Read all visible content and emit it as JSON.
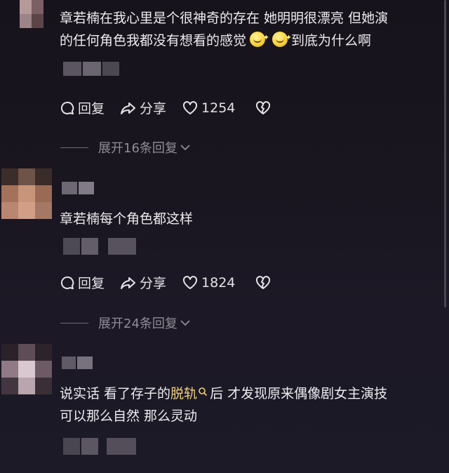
{
  "comments": [
    {
      "text_a": "章若楠在我心里是个很神奇的存在 她明明很漂亮 但她演",
      "text_b": "的任何角色我都没有想看的感觉",
      "text_c": "到底为什么啊",
      "emoji_name": "smile-emoji",
      "reply_label": "回复",
      "share_label": "分享",
      "like_count": "1254",
      "expand_label": "展开16条回复"
    },
    {
      "text_a": "章若楠每个角色都这样",
      "reply_label": "回复",
      "share_label": "分享",
      "like_count": "1824",
      "expand_label": "展开24条回复"
    },
    {
      "text_pre": "说实话 看了存子的",
      "text_hl": "脱轨",
      "text_post": "后 才发现原来偶像剧女主演技",
      "text_b": "可以那么自然 那么灵动"
    }
  ],
  "icons": {
    "reply": "comment-icon",
    "share": "share-icon",
    "like": "heart-icon",
    "dislike": "broken-heart-icon",
    "search": "search-icon",
    "expand": "chevron-down-icon"
  },
  "colors": {
    "highlight": "#f0d27b",
    "text": "#ececee",
    "muted": "#8e8d96"
  }
}
